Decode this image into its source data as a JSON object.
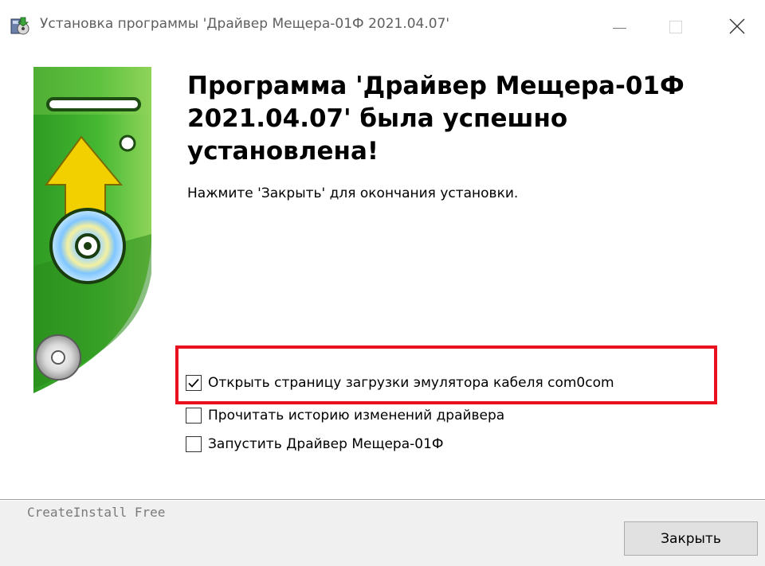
{
  "window": {
    "title": "Установка программы 'Драйвер Мещера-01Ф 2021.04.07'",
    "icon": "installer-icon",
    "controls": [
      "minimize-icon",
      "maximize-icon",
      "close-icon"
    ]
  },
  "main": {
    "heading": "Программа 'Драйвер Мещера-01Ф 2021.04.07' была успешно установлена!",
    "instruction": "Нажмите 'Закрыть' для окончания установки.",
    "options": [
      {
        "label": "Открыть страницу загрузки эмулятора кабеля com0com",
        "checked": true
      },
      {
        "label": "Прочитать историю изменений драйвера",
        "checked": false
      },
      {
        "label": "Запустить Драйвер Мещера-01Ф",
        "checked": false
      }
    ],
    "highlight_color": "#e8101e"
  },
  "footer": {
    "brand": "CreateInstall Free",
    "close_button": "Закрыть"
  },
  "colors": {
    "side_green": "#3aaa2a",
    "side_green_light": "#8ed05a",
    "arrow_yellow": "#f2d000"
  }
}
